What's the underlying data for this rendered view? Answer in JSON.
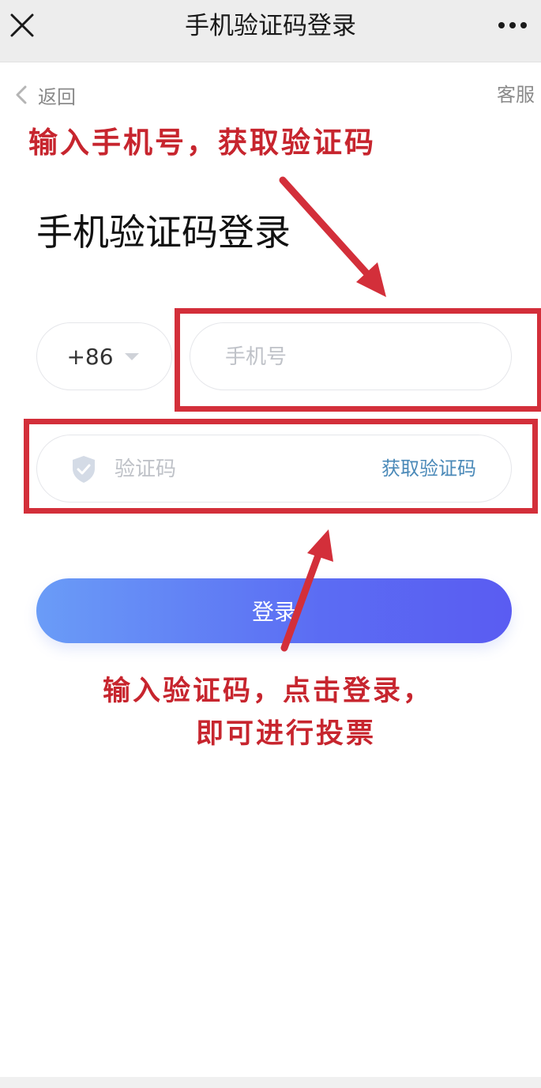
{
  "titlebar": {
    "title": "手机验证码登录"
  },
  "nav": {
    "back_label": "返回",
    "service_label": "客服"
  },
  "page": {
    "title": "手机验证码登录"
  },
  "form": {
    "country_code": "+86",
    "phone_placeholder": "手机号",
    "code_placeholder": "验证码",
    "get_code_label": "获取验证码",
    "login_label": "登录"
  },
  "annotations": {
    "note_1": "输入手机号，获取验证码",
    "note_2_line1": "输入验证码，点击登录，",
    "note_2_line2": "即可进行投票",
    "color": "#d32f3a"
  },
  "colors": {
    "button_gradient_start": "#6a9cf7",
    "button_gradient_end": "#5a5cf2",
    "link": "#4a89b8"
  },
  "icons": {
    "close": "close-icon",
    "more": "more-icon",
    "back": "chevron-left-icon",
    "dropdown": "caret-down-icon",
    "shield": "shield-check-icon"
  }
}
